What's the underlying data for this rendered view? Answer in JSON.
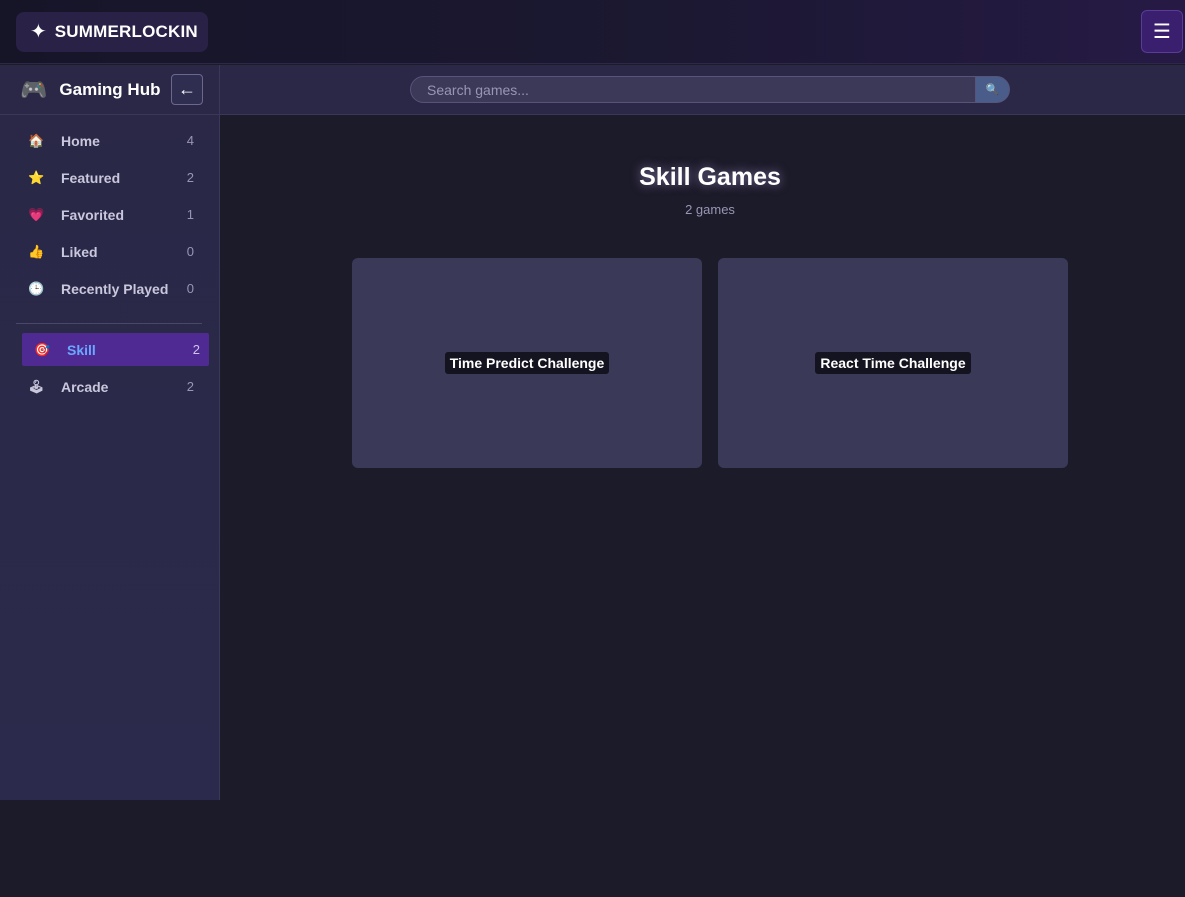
{
  "topbar": {
    "logo_icon": "✦",
    "logo_text": "SUMMERLOCKIN",
    "menu_icon": "☰"
  },
  "sidebar": {
    "icon": "🎮",
    "title": "Gaming Hub",
    "collapse_icon": "←",
    "items": [
      {
        "icon": "🏠",
        "label": "Home",
        "count": "4"
      },
      {
        "icon": "⭐",
        "label": "Featured",
        "count": "2"
      },
      {
        "icon": "💗",
        "label": "Favorited",
        "count": "1"
      },
      {
        "icon": "👍",
        "label": "Liked",
        "count": "0"
      },
      {
        "icon": "🕒",
        "label": "Recently Played",
        "count": "0"
      }
    ],
    "categories": [
      {
        "icon": "🎯",
        "label": "Skill",
        "count": "2",
        "active": true
      },
      {
        "icon": "🕹",
        "label": "Arcade",
        "count": "2",
        "active": false
      }
    ]
  },
  "search": {
    "placeholder": "Search games...",
    "value": "",
    "button_icon": "🔍"
  },
  "main": {
    "title": "Skill Games",
    "subtitle": "2 games",
    "games": [
      {
        "title": "Time Predict Challenge"
      },
      {
        "title": "React Time Challenge"
      }
    ]
  },
  "colors": {
    "accent": "#4f2a92",
    "active_text": "#6aa8ff",
    "background": "#1c1b29",
    "sidebar": "#2a2846",
    "card": "#3b3958"
  }
}
